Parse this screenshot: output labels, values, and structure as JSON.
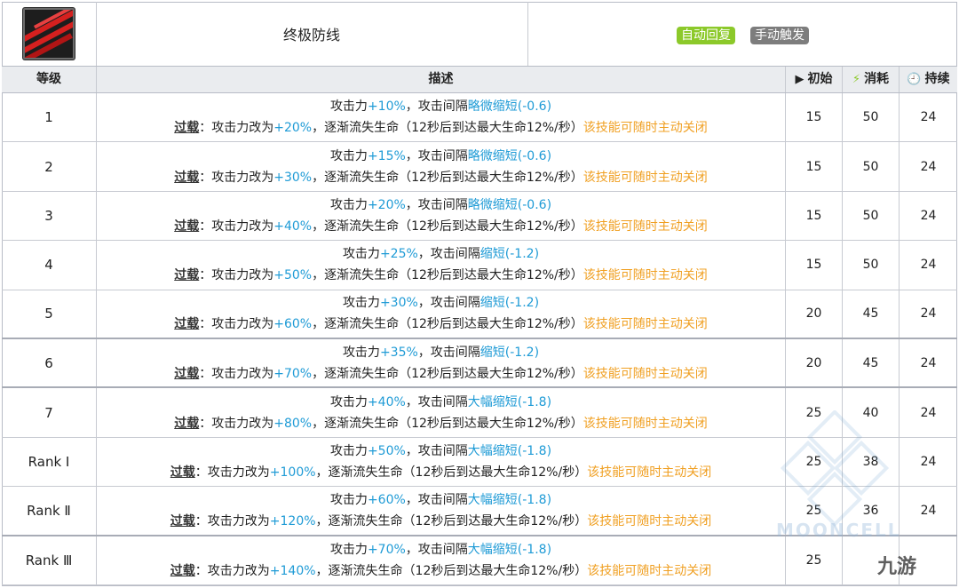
{
  "skill": {
    "icon": "skill-icon",
    "name": "终极防线",
    "tags": [
      "自动回复",
      "手动触发"
    ]
  },
  "header": {
    "level": "等级",
    "description": "描述",
    "initial": "初始",
    "cost": "消耗",
    "duration": "持续"
  },
  "rows": [
    {
      "level": "1",
      "atk": "+10%",
      "atk_prefix": "攻击力",
      "sep": "，攻击间隔",
      "interval": "略微缩短",
      "interval_val": "(-0.6)",
      "ol_label": "过载",
      "ol_text1": "：攻击力改为",
      "ol_atk": "+20%",
      "ol_text2": "，逐渐流失生命（12秒后到达最大生命12%/秒）",
      "ol_note": "该技能可随时主动关闭",
      "initial": "15",
      "cost": "50",
      "duration": "24"
    },
    {
      "level": "2",
      "atk": "+15%",
      "atk_prefix": "攻击力",
      "sep": "，攻击间隔",
      "interval": "略微缩短",
      "interval_val": "(-0.6)",
      "ol_label": "过载",
      "ol_text1": "：攻击力改为",
      "ol_atk": "+30%",
      "ol_text2": "，逐渐流失生命（12秒后到达最大生命12%/秒）",
      "ol_note": "该技能可随时主动关闭",
      "initial": "15",
      "cost": "50",
      "duration": "24"
    },
    {
      "level": "3",
      "atk": "+20%",
      "atk_prefix": "攻击力",
      "sep": "，攻击间隔",
      "interval": "略微缩短",
      "interval_val": "(-0.6)",
      "ol_label": "过载",
      "ol_text1": "：攻击力改为",
      "ol_atk": "+40%",
      "ol_text2": "，逐渐流失生命（12秒后到达最大生命12%/秒）",
      "ol_note": "该技能可随时主动关闭",
      "initial": "15",
      "cost": "50",
      "duration": "24"
    },
    {
      "level": "4",
      "atk": "+25%",
      "atk_prefix": "攻击力",
      "sep": "，攻击间隔",
      "interval": "缩短",
      "interval_val": "(-1.2)",
      "ol_label": "过载",
      "ol_text1": "：攻击力改为",
      "ol_atk": "+50%",
      "ol_text2": "，逐渐流失生命（12秒后到达最大生命12%/秒）",
      "ol_note": "该技能可随时主动关闭",
      "initial": "15",
      "cost": "50",
      "duration": "24"
    },
    {
      "level": "5",
      "atk": "+30%",
      "atk_prefix": "攻击力",
      "sep": "，攻击间隔",
      "interval": "缩短",
      "interval_val": "(-1.2)",
      "ol_label": "过载",
      "ol_text1": "：攻击力改为",
      "ol_atk": "+60%",
      "ol_text2": "，逐渐流失生命（12秒后到达最大生命12%/秒）",
      "ol_note": "该技能可随时主动关闭",
      "initial": "20",
      "cost": "45",
      "duration": "24"
    },
    {
      "level": "6",
      "atk": "+35%",
      "atk_prefix": "攻击力",
      "sep": "，攻击间隔",
      "interval": "缩短",
      "interval_val": "(-1.2)",
      "ol_label": "过载",
      "ol_text1": "：攻击力改为",
      "ol_atk": "+70%",
      "ol_text2": "，逐渐流失生命（12秒后到达最大生命12%/秒）",
      "ol_note": "该技能可随时主动关闭",
      "initial": "20",
      "cost": "45",
      "duration": "24"
    },
    {
      "level": "7",
      "atk": "+40%",
      "atk_prefix": "攻击力",
      "sep": "，攻击间隔",
      "interval": "大幅缩短",
      "interval_val": "(-1.8)",
      "ol_label": "过载",
      "ol_text1": "：攻击力改为",
      "ol_atk": "+80%",
      "ol_text2": "，逐渐流失生命（12秒后到达最大生命12%/秒）",
      "ol_note": "该技能可随时主动关闭",
      "initial": "25",
      "cost": "40",
      "duration": "24"
    },
    {
      "level": "Rank Ⅰ",
      "atk": "+50%",
      "atk_prefix": "攻击力",
      "sep": "，攻击间隔",
      "interval": "大幅缩短",
      "interval_val": "(-1.8)",
      "ol_label": "过载",
      "ol_text1": "：攻击力改为",
      "ol_atk": "+100%",
      "ol_text2": "，逐渐流失生命（12秒后到达最大生命12%/秒）",
      "ol_note": "该技能可随时主动关闭",
      "initial": "25",
      "cost": "38",
      "duration": "24"
    },
    {
      "level": "Rank Ⅱ",
      "atk": "+60%",
      "atk_prefix": "攻击力",
      "sep": "，攻击间隔",
      "interval": "大幅缩短",
      "interval_val": "(-1.8)",
      "ol_label": "过载",
      "ol_text1": "：攻击力改为",
      "ol_atk": "+120%",
      "ol_text2": "，逐渐流失生命（12秒后到达最大生命12%/秒）",
      "ol_note": "该技能可随时主动关闭",
      "initial": "25",
      "cost": "36",
      "duration": "24"
    },
    {
      "level": "Rank Ⅲ",
      "atk": "+70%",
      "atk_prefix": "攻击力",
      "sep": "，攻击间隔",
      "interval": "大幅缩短",
      "interval_val": "(-1.8)",
      "ol_label": "过载",
      "ol_text1": "：攻击力改为",
      "ol_atk": "+140%",
      "ol_text2": "，逐渐流失生命（12秒后到达最大生命12%/秒）",
      "ol_note": "该技能可随时主动关闭",
      "initial": "25",
      "cost": "",
      "duration": ""
    }
  ],
  "colors": {
    "highlight_blue": "#1f9bd6",
    "highlight_orange": "#f0a023",
    "tag_green": "#8cc92a",
    "tag_gray": "#7d7d7d",
    "header_bg": "#eaecef"
  },
  "watermark": {
    "text": "MOONCELL",
    "brand": "九游"
  }
}
